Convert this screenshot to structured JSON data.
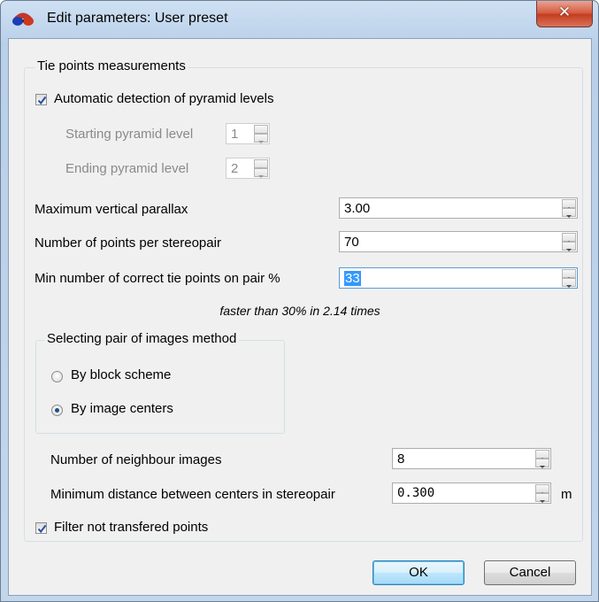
{
  "window": {
    "title": "Edit parameters: User preset",
    "close_glyph": "✕"
  },
  "tie_points": {
    "legend": "Tie points measurements",
    "auto_detect": {
      "label": "Automatic detection of pyramid levels",
      "checked": true
    },
    "starting_level": {
      "label": "Starting pyramid level",
      "value": "1"
    },
    "ending_level": {
      "label": "Ending pyramid level",
      "value": "2"
    },
    "max_vertical_parallax": {
      "label": "Maximum vertical parallax",
      "value": "3.00"
    },
    "points_per_stereopair": {
      "label": "Number of points per stereopair",
      "value": "70"
    },
    "min_correct_tie_points": {
      "label": "Min number of correct tie points on pair %",
      "value": "33"
    },
    "speed_note": "faster than 30% in 2.14 times"
  },
  "pair_selection": {
    "legend": "Selecting pair of images method",
    "options": [
      {
        "label": "By block scheme",
        "selected": false
      },
      {
        "label": "By image centers",
        "selected": true
      }
    ]
  },
  "neighbour_images": {
    "label": "Number of neighbour images",
    "value": "8"
  },
  "min_distance": {
    "label": "Minimum distance between centers in stereopair",
    "value": "0.300",
    "unit": "m"
  },
  "filter_points": {
    "label": "Filter not transfered points",
    "checked": true
  },
  "buttons": {
    "ok": "OK",
    "cancel": "Cancel"
  },
  "icons": {
    "app": "stereo-glasses-icon",
    "close": "close-icon",
    "check": "checkmark-icon",
    "spin_up": "arrow-up-icon",
    "spin_down": "arrow-down-icon"
  },
  "colors": {
    "selection": "#3399ff",
    "titlebar": "#c2d6ec",
    "close": "#c43b1d"
  }
}
